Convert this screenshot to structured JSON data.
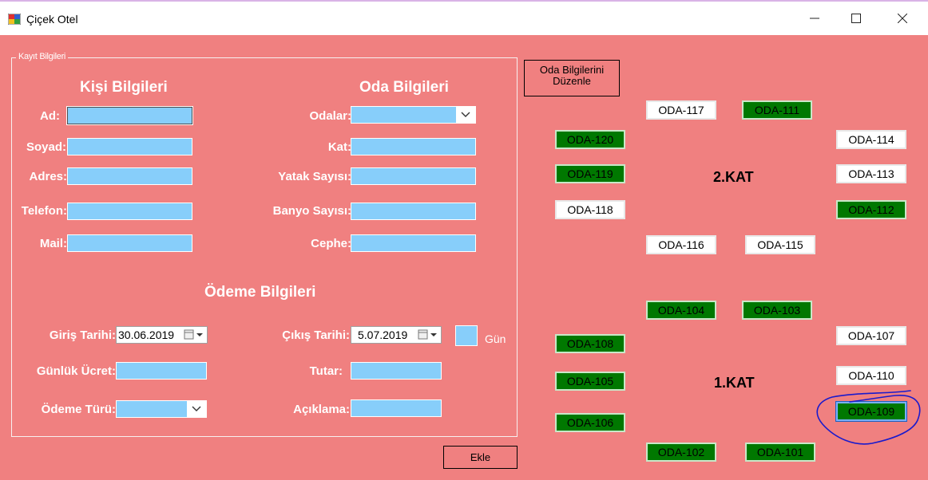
{
  "window": {
    "title": "Çiçek Otel",
    "minimize_glyph": "—",
    "maximize_glyph": "☐",
    "close_glyph": "✕"
  },
  "colors": {
    "background": "#f08080",
    "field": "#87cefa",
    "room_full": "#007800",
    "room_empty": "#ffffff",
    "annotation_ink": "#1a1acc"
  },
  "group": {
    "legend": "Kayıt Bilgileri"
  },
  "person": {
    "title": "Kişi Bilgileri",
    "ad_label": "Ad:",
    "soyad_label": "Soyad:",
    "adres_label": "Adres:",
    "telefon_label": "Telefon:",
    "mail_label": "Mail:",
    "ad_value": "",
    "soyad_value": "",
    "adres_value": "",
    "telefon_value": "",
    "mail_value": ""
  },
  "room_info": {
    "title": "Oda Bilgileri",
    "odalar_label": "Odalar:",
    "kat_label": "Kat:",
    "yatak_label": "Yatak Sayısı:",
    "banyo_label": "Banyo Sayısı:",
    "cephe_label": "Cephe:",
    "odalar_value": "",
    "kat_value": "",
    "yatak_value": "",
    "banyo_value": "",
    "cephe_value": ""
  },
  "payment": {
    "title": "Ödeme Bilgileri",
    "giris_label": "Giriş Tarihi:",
    "giris_value": "30.06.2019",
    "cikis_label": "Çıkış Tarihi:",
    "cikis_value": "5.07.2019",
    "gun_label": "Gün",
    "gunluk_label": "Günlük Ücret:",
    "tutar_label": "Tutar:",
    "odeme_turu_label": "Ödeme Türü:",
    "aciklama_label": "Açıklama:"
  },
  "buttons": {
    "edit_rooms": "Oda Bilgilerini Düzenle",
    "add": "Ekle"
  },
  "floors": {
    "second": "2.KAT",
    "first": "1.KAT"
  },
  "rooms": {
    "r117": {
      "label": "ODA-117",
      "status": "empty"
    },
    "r111": {
      "label": "ODA-111",
      "status": "full"
    },
    "r120": {
      "label": "ODA-120",
      "status": "full"
    },
    "r114": {
      "label": "ODA-114",
      "status": "empty"
    },
    "r119": {
      "label": "ODA-119",
      "status": "full"
    },
    "r113": {
      "label": "ODA-113",
      "status": "empty"
    },
    "r118": {
      "label": "ODA-118",
      "status": "empty"
    },
    "r112": {
      "label": "ODA-112",
      "status": "full"
    },
    "r116": {
      "label": "ODA-116",
      "status": "empty"
    },
    "r115": {
      "label": "ODA-115",
      "status": "empty"
    },
    "r104": {
      "label": "ODA-104",
      "status": "full"
    },
    "r103": {
      "label": "ODA-103",
      "status": "full"
    },
    "r107": {
      "label": "ODA-107",
      "status": "empty"
    },
    "r108": {
      "label": "ODA-108",
      "status": "full"
    },
    "r110": {
      "label": "ODA-110",
      "status": "empty"
    },
    "r105": {
      "label": "ODA-105",
      "status": "full"
    },
    "r109": {
      "label": "ODA-109",
      "status": "full"
    },
    "r106": {
      "label": "ODA-106",
      "status": "full"
    },
    "r102": {
      "label": "ODA-102",
      "status": "full"
    },
    "r101": {
      "label": "ODA-101",
      "status": "full"
    }
  }
}
